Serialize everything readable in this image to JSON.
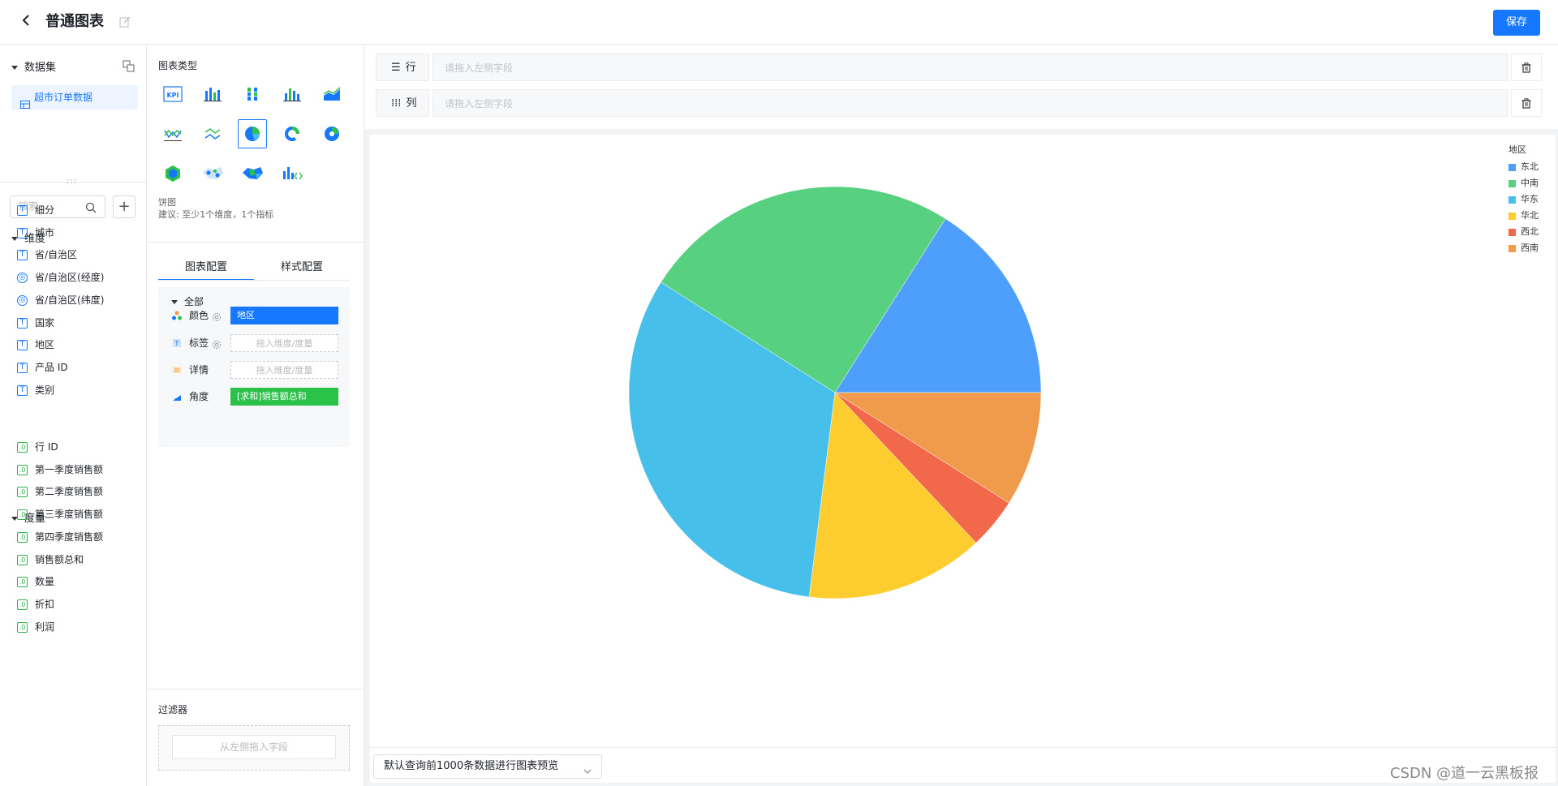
{
  "header": {
    "title": "普通图表",
    "save_label": "保存"
  },
  "dataset_panel": {
    "section_title": "数据集",
    "dataset_item": "超市订单数据",
    "search_placeholder": "搜索",
    "add_label": "+",
    "dimensions_title": "维度",
    "dimensions": [
      {
        "label": "细分",
        "type": "T"
      },
      {
        "label": "城市",
        "type": "T"
      },
      {
        "label": "省/自治区",
        "type": "T"
      },
      {
        "label": "省/自治区(经度)",
        "type": "geo"
      },
      {
        "label": "省/自治区(纬度)",
        "type": "geo"
      },
      {
        "label": "国家",
        "type": "T"
      },
      {
        "label": "地区",
        "type": "T"
      },
      {
        "label": "产品 ID",
        "type": "T"
      },
      {
        "label": "类别",
        "type": "T"
      }
    ],
    "measures_title": "度量",
    "measures": [
      {
        "label": "行 ID",
        "type": ".0"
      },
      {
        "label": "第一季度销售额",
        "type": ".0"
      },
      {
        "label": "第二季度销售额",
        "type": ".0"
      },
      {
        "label": "第三季度销售额",
        "type": ".0"
      },
      {
        "label": "第四季度销售额",
        "type": ".0"
      },
      {
        "label": "销售额总和",
        "type": ".0"
      },
      {
        "label": "数量",
        "type": ".0"
      },
      {
        "label": "折扣",
        "type": ".0"
      },
      {
        "label": "利润",
        "type": ".0"
      }
    ]
  },
  "config_panel": {
    "chart_types_title": "图表类型",
    "chart_types": [
      "kpi-icon",
      "bar-chart-icon",
      "stacked-bar-icon",
      "grouped-bar-icon",
      "area-chart-icon",
      "line-chart-icon",
      "multi-line-icon",
      "pie-chart-icon",
      "donut-chart-icon",
      "rose-chart-icon",
      "hexagon-icon",
      "scatter-map-icon",
      "region-map-icon",
      "custom-chart-icon"
    ],
    "selected_chart_type": "pie-chart-icon",
    "selected_name": "饼图",
    "hint": "建议: 至少1个维度，1个指标",
    "tab_chart": "图表配置",
    "tab_style": "样式配置",
    "group_all": "全部",
    "rows": {
      "color_label": "颜色",
      "color_value": "地区",
      "label_label": "标签",
      "label_placeholder": "拖入维度/度量",
      "detail_label": "详情",
      "detail_placeholder": "拖入维度/度量",
      "angle_label": "角度",
      "angle_value": "[求和]销售额总和"
    },
    "filter_title": "过滤器",
    "filter_placeholder": "从左侧拖入字段"
  },
  "canvas": {
    "row_shelf_label": "行",
    "col_shelf_label": "列",
    "shelf_placeholder": "请拖入左侧字段",
    "preview_select": "默认查询前1000条数据进行图表预览"
  },
  "chart_data": {
    "type": "pie",
    "legend_title": "地区",
    "legend_position": "top-right",
    "categories": [
      "东北",
      "中南",
      "华东",
      "华北",
      "西北",
      "西南"
    ],
    "values": [
      16.0,
      25.0,
      32.0,
      14.0,
      4.0,
      9.0
    ],
    "colors": [
      "#4e9ffb",
      "#57d07f",
      "#47bfeb",
      "#fdcd2f",
      "#f2684a",
      "#f09b4b"
    ]
  },
  "watermark": "CSDN @道一云黑板报"
}
